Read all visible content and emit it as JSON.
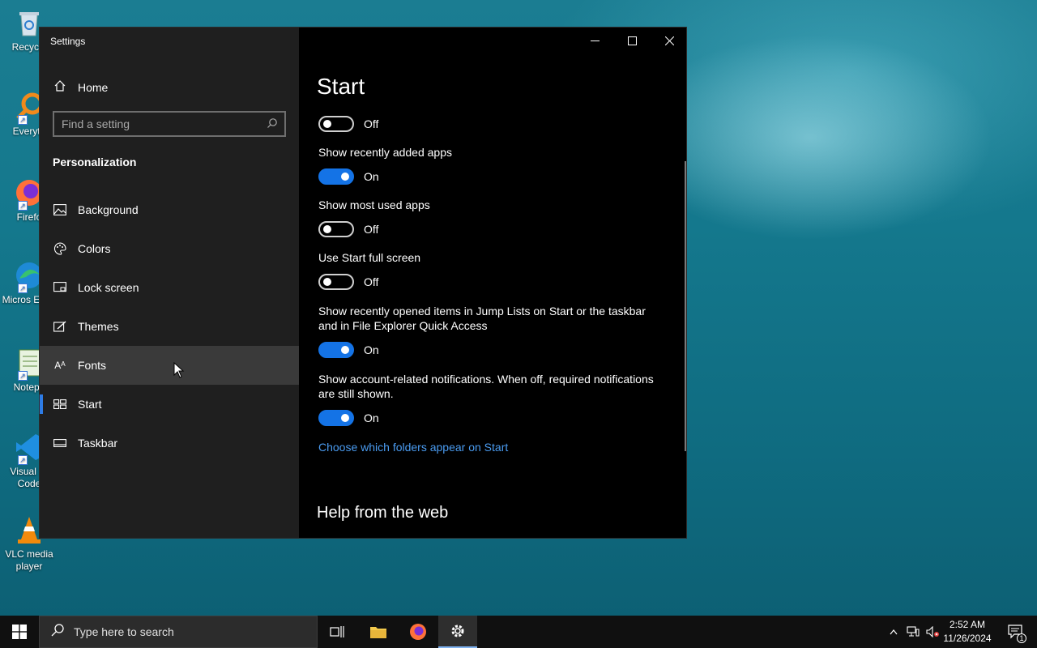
{
  "desktop": {
    "icons": [
      {
        "label": "Recycle"
      },
      {
        "label": "Everyth"
      },
      {
        "label": "Firefo"
      },
      {
        "label": "Micros Edge"
      },
      {
        "label": "Notepa"
      },
      {
        "label": "Visual St Code"
      },
      {
        "label": "VLC media player"
      }
    ]
  },
  "window": {
    "title": "Settings",
    "controls": {
      "minimize": "—",
      "maximize": "☐",
      "close": "✕"
    }
  },
  "sidebar": {
    "home_label": "Home",
    "search_placeholder": "Find a setting",
    "section": "Personalization",
    "items": [
      {
        "label": "Background",
        "icon": "image-icon"
      },
      {
        "label": "Colors",
        "icon": "palette-icon"
      },
      {
        "label": "Lock screen",
        "icon": "lock-screen-icon"
      },
      {
        "label": "Themes",
        "icon": "brush-icon"
      },
      {
        "label": "Fonts",
        "icon": "font-icon"
      },
      {
        "label": "Start",
        "icon": "start-layout-icon"
      },
      {
        "label": "Taskbar",
        "icon": "taskbar-icon"
      }
    ],
    "hovered": "Fonts",
    "selected": "Start"
  },
  "content": {
    "title": "Start",
    "settings": [
      {
        "label": "",
        "state": "Off",
        "on": false
      },
      {
        "label": "Show recently added apps",
        "state": "On",
        "on": true
      },
      {
        "label": "Show most used apps",
        "state": "Off",
        "on": false
      },
      {
        "label": "Use Start full screen",
        "state": "Off",
        "on": false
      },
      {
        "label": "Show recently opened items in Jump Lists on Start or the taskbar and in File Explorer Quick Access",
        "state": "On",
        "on": true
      },
      {
        "label": "Show account-related notifications. When off, required notifications are still shown.",
        "state": "On",
        "on": true
      }
    ],
    "link": "Choose which folders appear on Start",
    "help_heading": "Help from the web"
  },
  "taskbar": {
    "search_placeholder": "Type here to search",
    "clock_time": "2:52 AM",
    "clock_date": "11/26/2024",
    "notification_count": "1"
  },
  "colors": {
    "accent": "#1473e6",
    "link": "#4a9bf0",
    "sidebar_bg": "#1f1f1f",
    "content_bg": "#000000"
  }
}
